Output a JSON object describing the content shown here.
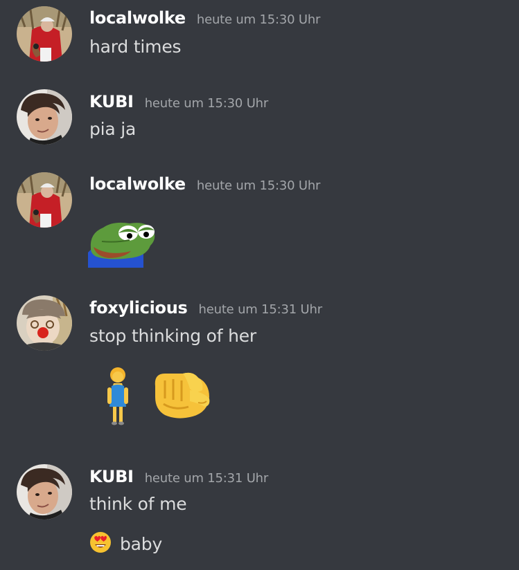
{
  "messages": [
    {
      "username": "localwolke",
      "timestamp": "heute um 15:30 Uhr",
      "text": "hard times",
      "avatar_icon": "santa-reindeer-avatar"
    },
    {
      "username": "KUBI",
      "timestamp": "heute um 15:30 Uhr",
      "text": "pia ja",
      "avatar_icon": "selfie-avatar"
    },
    {
      "username": "localwolke",
      "timestamp": "heute um 15:30 Uhr",
      "text": "",
      "attachment_icon": "pepe-frog-emoji",
      "avatar_icon": "santa-reindeer-avatar"
    },
    {
      "username": "foxylicious",
      "timestamp": "heute um 15:31 Uhr",
      "text": "stop thinking of her",
      "emojis": [
        "woman-standing-emoji",
        "pointing-hand-emoji"
      ],
      "avatar_icon": "reindeer-nose-avatar"
    },
    {
      "username": "KUBI",
      "timestamp": "heute um 15:31 Uhr",
      "text": "think of me",
      "text2": "baby",
      "text2_emoji": "heart-eyes-emoji",
      "avatar_icon": "selfie-avatar"
    }
  ],
  "colors": {
    "background": "#36393f",
    "username": "#ffffff",
    "timestamp": "#a3a6aa",
    "message_text": "#dcddde"
  }
}
